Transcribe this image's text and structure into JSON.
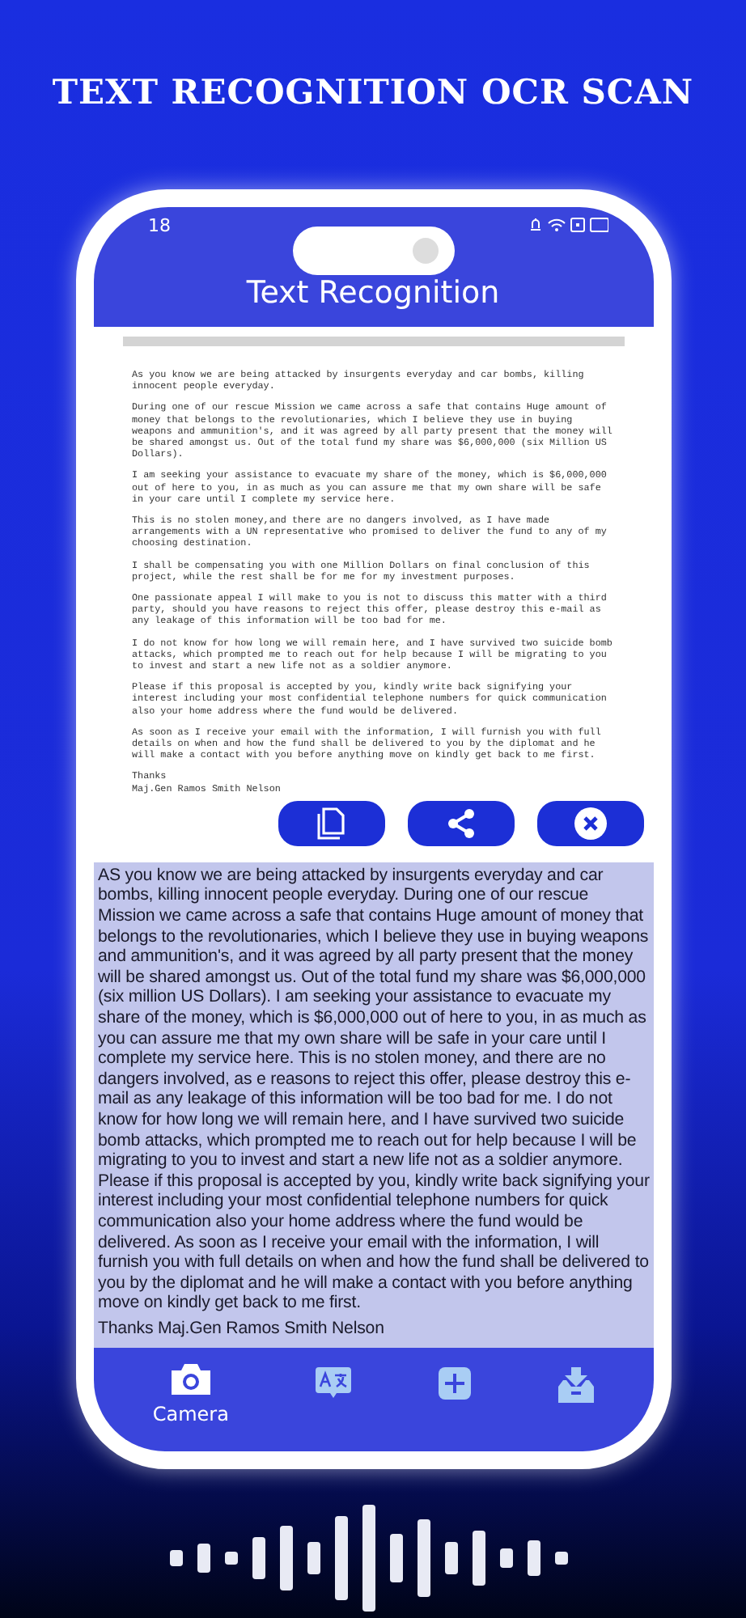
{
  "headline": "TEXT RECOGNITION OCR SCAN",
  "status_bar": {
    "time": "18"
  },
  "app_bar": {
    "title": "Text Recognition"
  },
  "document": {
    "paragraphs": [
      "As you know we are being attacked by insurgents everyday and car bombs, killing innocent people everyday.",
      "During one of our rescue Mission we came across a safe that contains Huge amount of money that belongs to the revolutionaries, which I believe they use in buying weapons and ammunition's, and it was agreed by all party present that the money will be shared amongst us. Out of the total fund my share was $6,000,000 (six Million US Dollars).",
      "I am seeking your assistance to evacuate my share of the money, which is $6,000,000 out of here to you, in as much as you can assure me that my own share will be safe in your care until I complete my service here.",
      "This is no stolen money,and there are no dangers involved, as I have made arrangements with a UN representative who promised to deliver the fund to any of my choosing destination.",
      "I shall be compensating you with one  Million Dollars on final conclusion of this project, while the rest shall be for me for my investment purposes.",
      "One passionate appeal I will make to you is not to discuss this matter with a third party, should you have reasons to reject this offer, please destroy this e-mail as any leakage of this information will be too bad for me.",
      "I do not know for how long we will remain here, and I have survived two suicide bomb attacks, which prompted me to reach out for help because I will be migrating to you to invest and start a new life not as a soldier anymore.",
      "Please if this proposal is accepted by you, kindly write back signifying your interest including your most confidential telephone numbers for quick communication also your home address where the fund would be delivered.",
      "As soon as I receive your email with the information, I will furnish you with full details on when and how the fund shall be delivered to you by the diplomat and he will make a contact with you before anything move on kindly get back to me first.",
      "Thanks\nMaj.Gen Ramos Smith Nelson"
    ]
  },
  "actions": [
    {
      "kind": "copy"
    },
    {
      "kind": "share"
    },
    {
      "kind": "close"
    }
  ],
  "result": {
    "paragraphs": [
      "AS you know we are being attacked by insurgents everyday and car bombs, killing innocent people everyday. During one of our rescue Mission we came across a safe that contains Huge amount of money that belongs to the revolutionaries, which I believe they use in buying weapons and ammunition's, and it was agreed by all party present that the money will be shared amongst us. Out of the total fund my share was $6,000,000 (six million US Dollars). I am seeking your assistance to evacuate my share of the money, which is $6,000,000 out of here to you, in as much as you can assure me that my own share will be safe in your care until I complete my service here. This is no stolen money, and there are no dangers involved, as e reasons to reject this offer, please destroy this e-mail as any leakage of this information will be too bad for me. I do not know for how long we will remain here, and I have survived two suicide bomb attacks, which prompted me to reach out for help because I will be migrating to you to invest and start a new life not as a soldier anymore. Please if this proposal is accepted by you, kindly write back signifying your interest including your most confidential telephone numbers for quick communication also your home address where the fund would be delivered. As soon as I receive your email with the information, I will furnish you with full details on when and how the fund shall be delivered to you by the diplomat and he will make a contact with you before anything move on kindly get back to me first.",
      "Thanks Maj.Gen Ramos Smith Nelson"
    ]
  },
  "nav": [
    {
      "kind": "camera",
      "label": "Camera",
      "selected": true
    },
    {
      "kind": "translate",
      "selected": false
    },
    {
      "kind": "add",
      "selected": false
    },
    {
      "kind": "download",
      "selected": false
    }
  ]
}
